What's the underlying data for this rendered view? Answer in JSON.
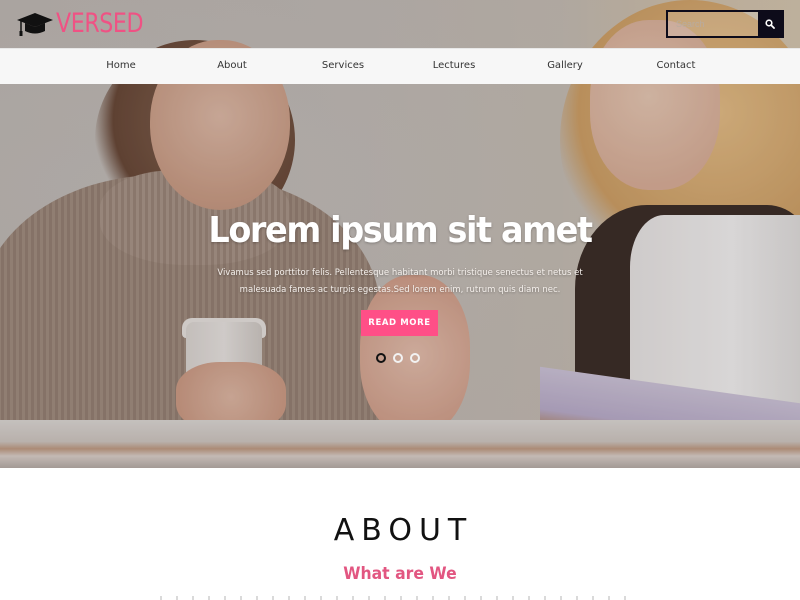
{
  "brand": {
    "name": "VERSED",
    "icon": "graduation-cap-icon",
    "accent_color": "#ef5284"
  },
  "search": {
    "placeholder": "Search",
    "value": "",
    "button_icon": "search-icon"
  },
  "nav": {
    "items": [
      {
        "label": "Home"
      },
      {
        "label": "About"
      },
      {
        "label": "Services"
      },
      {
        "label": "Lectures"
      },
      {
        "label": "Gallery"
      },
      {
        "label": "Contact"
      }
    ]
  },
  "hero": {
    "title": "Lorem ipsum sit amet",
    "text": "Vivamus sed porttitor felis. Pellentesque habitant morbi tristique senectus et netus et malesuada fames ac turpis egestas.Sed lorem enim, rutrum quis diam nec.",
    "button_label": "READ MORE",
    "button_color": "#ff4f87",
    "slides": {
      "count": 3,
      "active_index": 0
    }
  },
  "about": {
    "title": "ABOUT",
    "subtitle": "What are We",
    "subtitle_color": "#e25681"
  }
}
